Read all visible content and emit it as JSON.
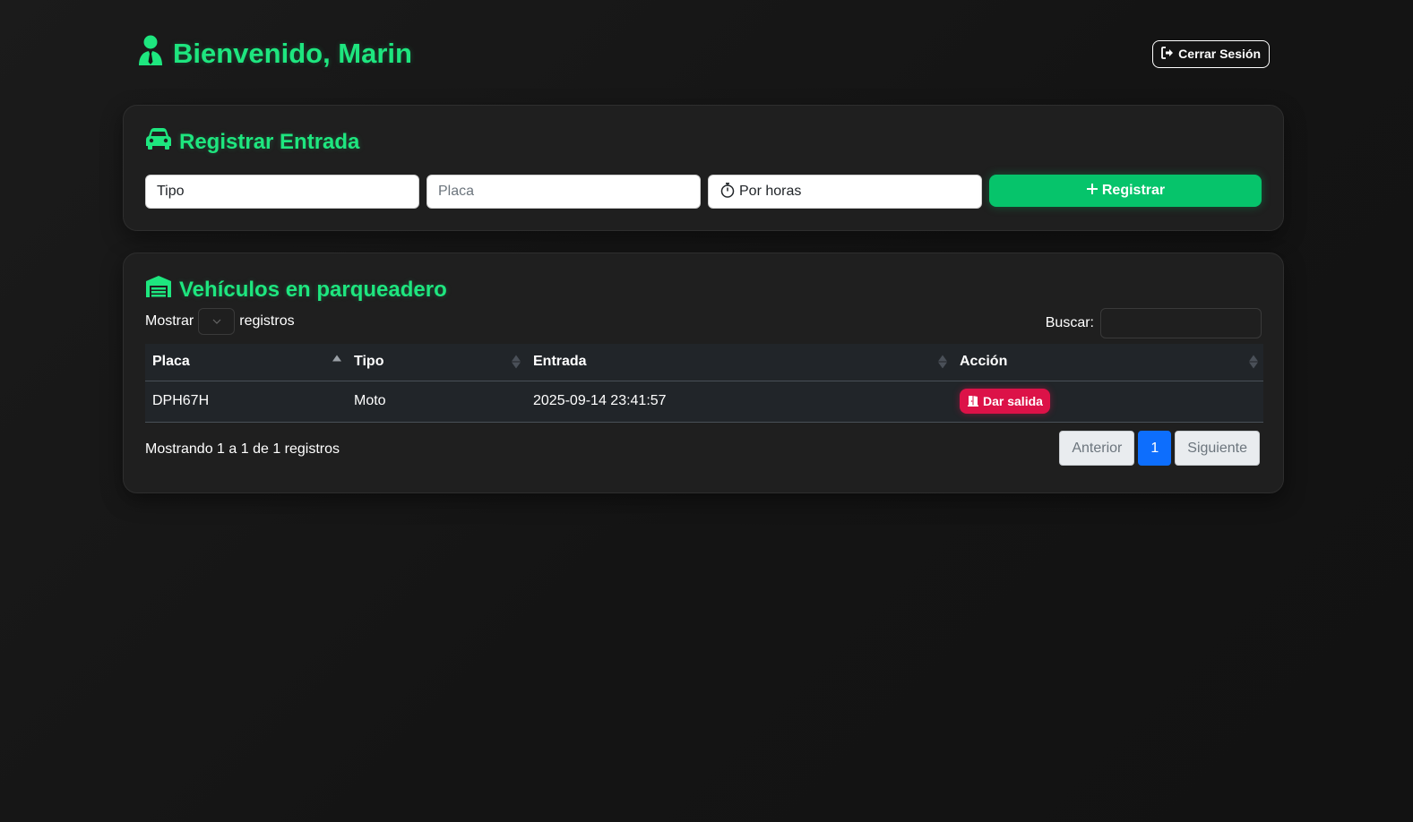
{
  "header": {
    "welcome": "Bienvenido, Marin",
    "logout_label": "Cerrar Sesión"
  },
  "entry": {
    "title": "Registrar Entrada",
    "tipo_value": "Tipo",
    "placa_placeholder": "Placa",
    "modalidad_value": "Por horas",
    "register_label": "Registrar"
  },
  "vehicles": {
    "title": "Vehículos en parqueadero",
    "show_label": "Mostrar",
    "records_label": "registros",
    "search_label": "Buscar:",
    "columns": [
      "Placa",
      "Tipo",
      "Entrada",
      "Acción"
    ],
    "rows": [
      {
        "placa": "DPH67H",
        "tipo": "Moto",
        "entrada": "2025-09-14 23:41:57",
        "action_label": "Dar salida"
      }
    ],
    "info": "Mostrando 1 a 1 de 1 registros",
    "pager": {
      "prev": "Anterior",
      "current": "1",
      "next": "Siguiente"
    }
  },
  "colors": {
    "accent_green": "#1ee67f",
    "button_green": "#06c46b",
    "danger": "#dc1248",
    "page_blue": "#0d6efd"
  }
}
